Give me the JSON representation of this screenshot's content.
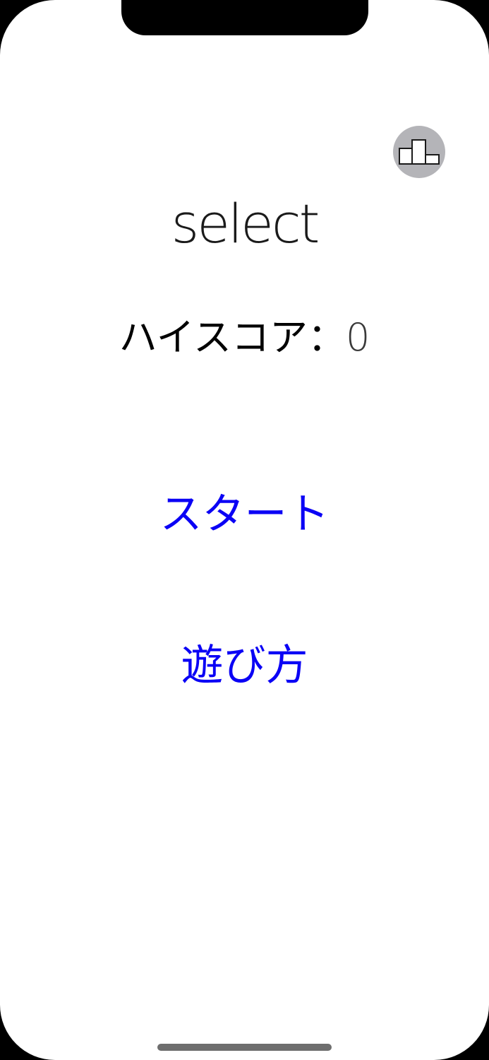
{
  "screen": {
    "title": "select",
    "leaderboard_icon": "leaderboard-podium-icon"
  },
  "highscore": {
    "label": "ハイスコア：",
    "value": "0"
  },
  "menu": {
    "start_label": "スタート",
    "howto_label": "遊び方"
  },
  "colors": {
    "accent": "#0a00f5",
    "icon_background": "#b4b4b8",
    "text": "#000000",
    "background": "#ffffff"
  }
}
